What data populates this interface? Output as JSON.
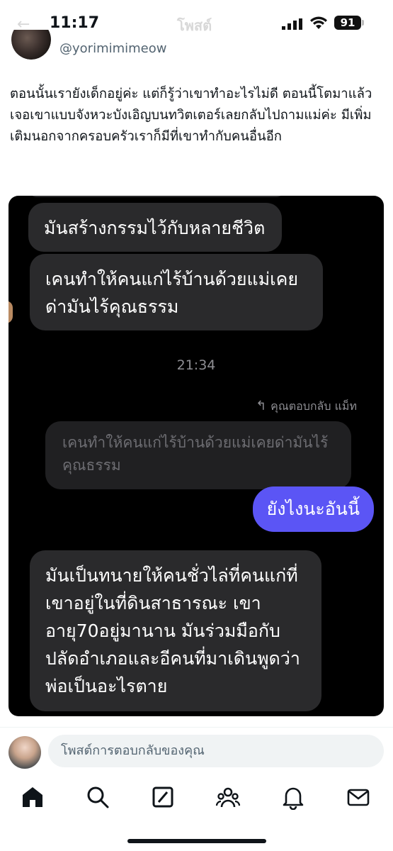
{
  "status_bar": {
    "time": "11:17",
    "battery": "91",
    "nav_title_faded": "โพสต์"
  },
  "post": {
    "handle": "@yorimimimeow",
    "text": "ตอนนั้นเรายังเด็กอยู่ค่ะ แต่ก็รู้ว่าเขาทำอะไรไม่ดี ตอนนี้โตมาแล้วเจอเขาแบบจังหวะบังเอิญบนทวิตเตอร์เลยกลับไปถามแม่ค่ะ มีเพิ่มเติมนอกจากครอบครัวเราก็มีที่เขาทำกับคนอื่นอีก"
  },
  "chat_screenshot": {
    "messages": [
      {
        "side": "incoming",
        "text": "มันสร้างกรรมไว้กับหลายชีวิต"
      },
      {
        "side": "incoming",
        "text": "เคนทำให้คนแก่ไร้บ้านด้วยแม่เคยด่ามันไร้คุณธรรม"
      }
    ],
    "timestamp": "21:34",
    "reply_label": "คุณตอบกลับ แม็ท",
    "quoted_text": "เคนทำให้คนแก่ไร้บ้านด้วยแม่เคยด่ามันไร้คุณธรรม",
    "outgoing_text": "ยังไงนะอันนี้",
    "last_incoming": "มันเป็นทนายให้คนชั่วไล่ที่คนแก่ที่เขาอยู่ในที่ดินสาธารณะ เขาอายุ70อยู่มานาน มันร่วมมือกับปลัดอำเภอและอีคนที่มาเดินพูดว่าพ่อเป็นอะไรตาย"
  },
  "reply_bar": {
    "placeholder": "โพสต์การตอบกลับของคุณ"
  },
  "colors": {
    "accent_bubble": "#5b55f5",
    "incoming_bubble": "#2a2a2c",
    "chat_bg": "#000000"
  },
  "tab_icons": [
    "home-icon",
    "search-icon",
    "grok-icon",
    "communities-icon",
    "notifications-icon",
    "messages-icon"
  ]
}
